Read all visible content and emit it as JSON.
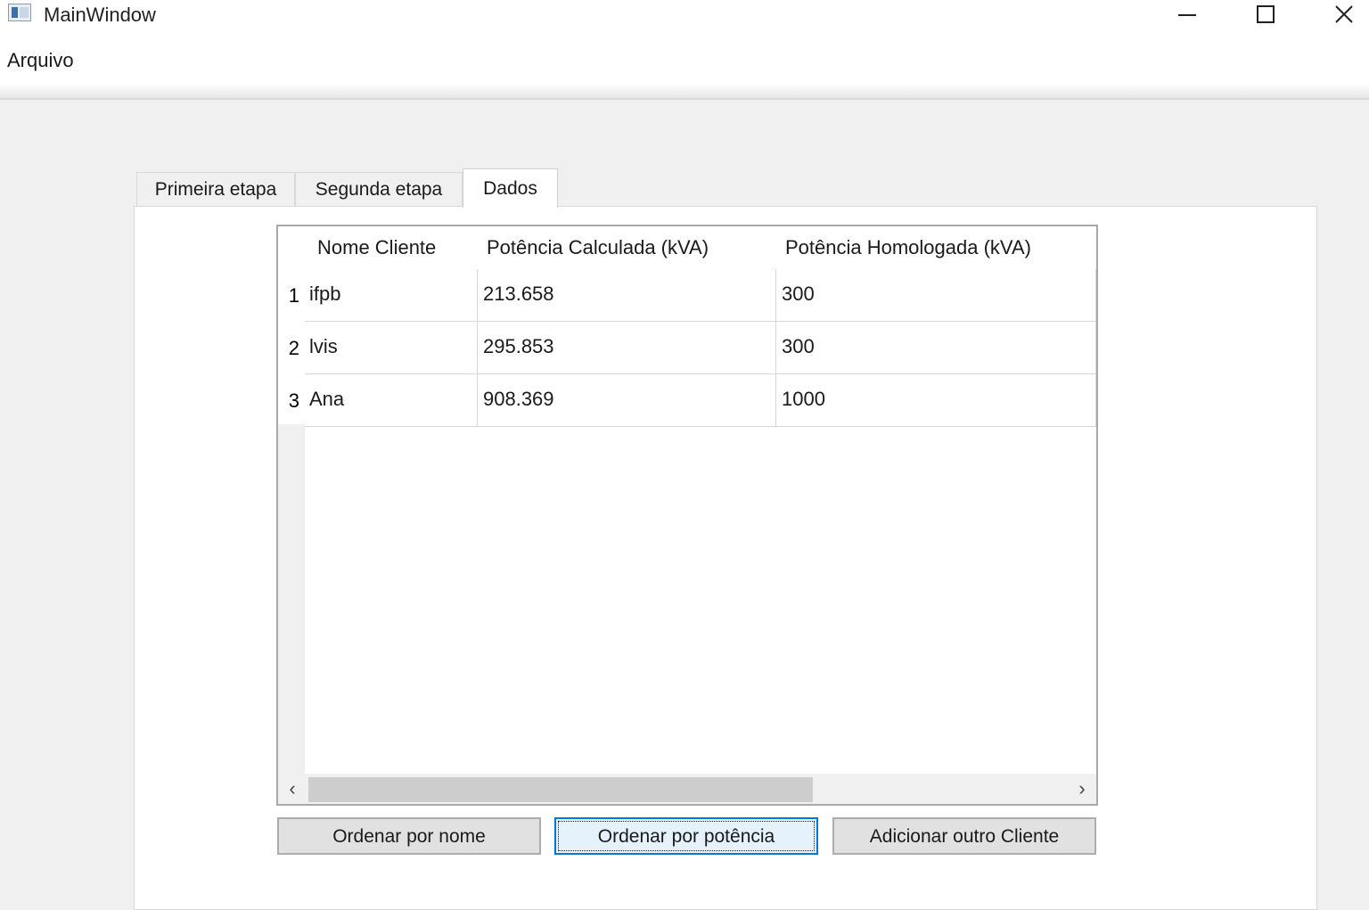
{
  "window": {
    "title": "MainWindow",
    "controls": [
      "minimize-icon",
      "maximize-icon",
      "close-icon"
    ]
  },
  "menubar": {
    "items": [
      {
        "label": "Arquivo"
      }
    ]
  },
  "tabs": [
    {
      "label": "Primeira etapa",
      "active": false
    },
    {
      "label": "Segunda etapa",
      "active": false
    },
    {
      "label": "Dados",
      "active": true
    }
  ],
  "table": {
    "columns": [
      "Nome Cliente",
      "Potência Calculada (kVA)",
      "Potência Homologada (kVA)"
    ],
    "rows": [
      {
        "num": "1",
        "cells": [
          "ifpb",
          "213.658",
          "300"
        ]
      },
      {
        "num": "2",
        "cells": [
          "lvis",
          "295.853",
          "300"
        ]
      },
      {
        "num": "3",
        "cells": [
          "Ana",
          "908.369",
          "1000"
        ]
      }
    ],
    "scrollbar": {
      "left_arrow": "‹",
      "right_arrow": "›"
    }
  },
  "buttons": {
    "sort_by_name": "Ordenar por nome",
    "sort_by_power": "Ordenar por potência",
    "add_client": "Adicionar outro Cliente"
  },
  "colors": {
    "focus_border": "#0078d7",
    "window_bg": "#f0f0f0"
  }
}
